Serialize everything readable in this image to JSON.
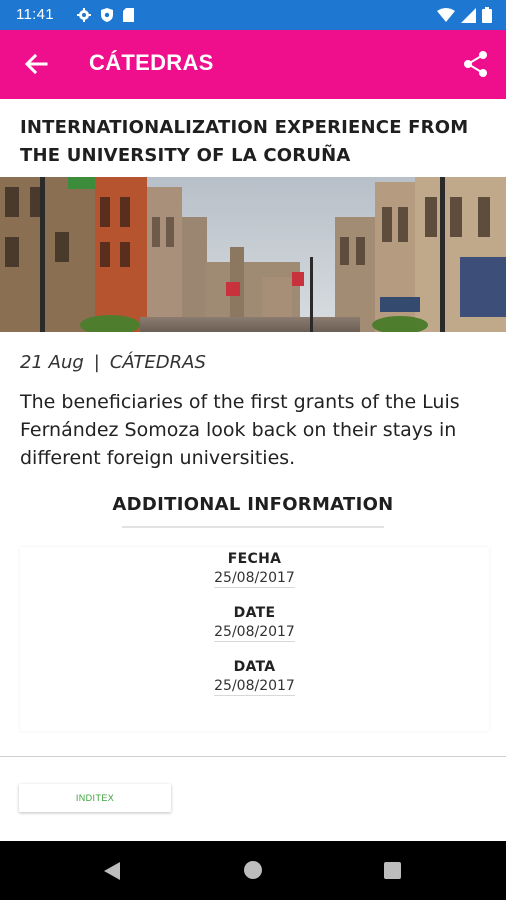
{
  "status_bar": {
    "time": "11:41",
    "icons_left": [
      "gear-icon",
      "shield-icon",
      "sd-card-icon"
    ],
    "icons_right": [
      "wifi-icon",
      "cell-signal-icon",
      "battery-icon"
    ],
    "color": "#1e78d2"
  },
  "app_bar": {
    "title": "CÁTEDRAS",
    "back_icon": "arrow-back-icon",
    "share_icon": "share-icon",
    "color": "#ef0f8c"
  },
  "article": {
    "title": "INTERNATIONALIZATION EXPERIENCE FROM THE UNIVERSITY OF LA CORUÑA",
    "date": "21 Aug",
    "separator": "|",
    "category": "CÁTEDRAS",
    "summary": "The beneficiaries of the first grants of the Luis Fernández Somoza look back on their stays in different foreign universities."
  },
  "additional_info": {
    "heading": "ADDITIONAL INFORMATION",
    "items": [
      {
        "label": "FECHA",
        "value": "25/08/2017"
      },
      {
        "label": "DATE",
        "value": "25/08/2017"
      },
      {
        "label": "DATA",
        "value": "25/08/2017"
      }
    ]
  },
  "sponsor": {
    "label": "INDITEX",
    "color": "#3aa03a"
  },
  "nav_bar": {
    "icons": [
      "nav-back-icon",
      "nav-home-icon",
      "nav-recents-icon"
    ]
  }
}
